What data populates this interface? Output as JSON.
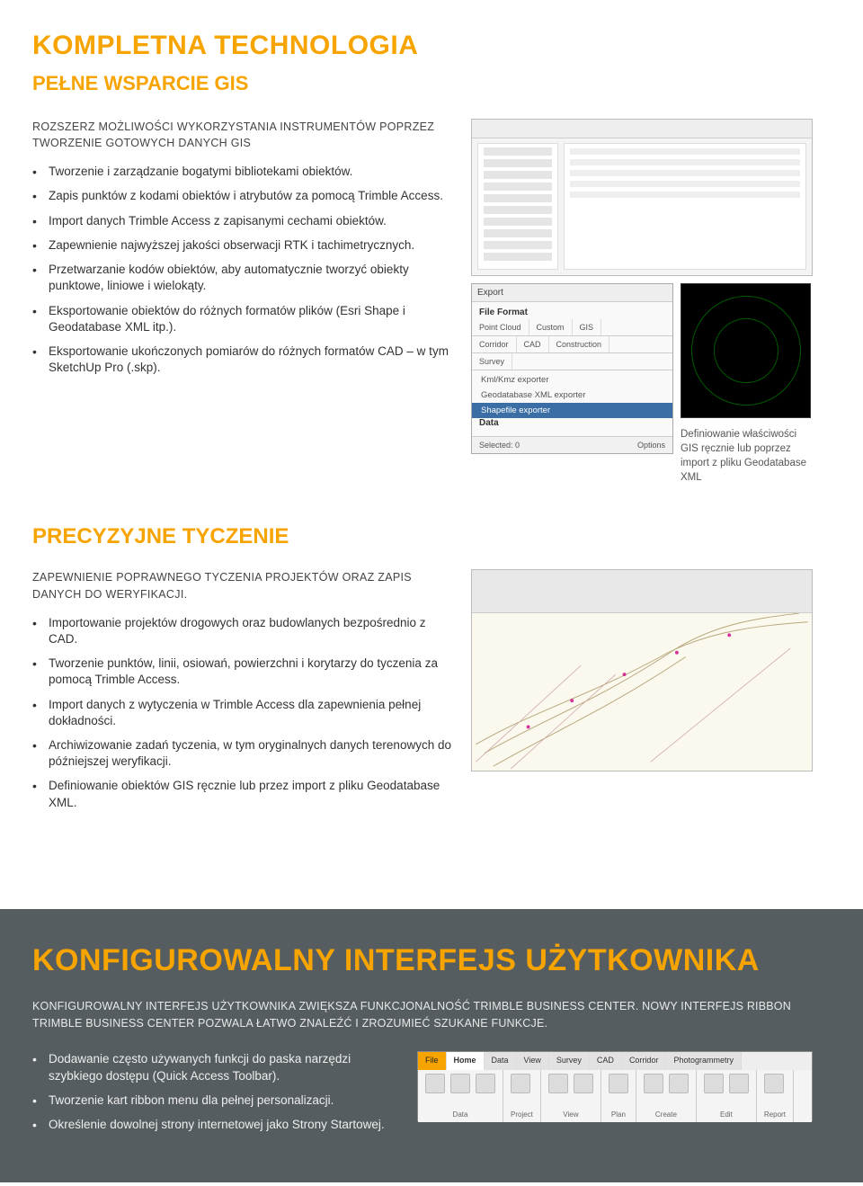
{
  "section1": {
    "title": "KOMPLETNA TECHNOLOGIA",
    "subtitle": "PEŁNE WSPARCIE GIS",
    "lead": "ROZSZERZ MOŻLIWOŚCI WYKORZYSTANIA INSTRUMENTÓW POPRZEZ TWORZENIE GOTOWYCH DANYCH GIS",
    "bullets": [
      "Tworzenie i zarządzanie bogatymi bibliotekami obiektów.",
      "Zapis punktów z kodami obiektów i atrybutów za pomocą Trimble Access.",
      "Import danych Trimble Access z zapisanymi cechami obiektów.",
      "Zapewnienie najwyższej jakości obserwacji RTK i tachimetrycznych.",
      "Przetwarzanie kodów obiektów, aby automatycznie tworzyć obiekty punktowe, liniowe i wielokąty.",
      "Eksportowanie obiektów do różnych formatów plików (Esri Shape i Geodatabase XML itp.).",
      "Eksportowanie ukończonych pomiarów do różnych formatów CAD – w tym SketchUp Pro (.skp)."
    ],
    "export_panel": {
      "title": "Export",
      "section": "File Format",
      "rows": [
        "Point Cloud",
        "Corridor",
        "Survey"
      ],
      "cols": [
        "Custom",
        "CAD",
        "GIS",
        "Construction"
      ],
      "list": [
        "Kml/Kmz exporter",
        "Geodatabase XML exporter",
        "Shapefile exporter"
      ],
      "selected_index": 2,
      "footer_label": "Data",
      "footer_status": "Selected: 0",
      "footer_button": "Options"
    },
    "caption": "Definiowanie właściwości GIS ręcznie lub poprzez import z pliku Geodatabase XML"
  },
  "section2": {
    "title": "PRECYZYJNE TYCZENIE",
    "lead": "ZAPEWNIENIE POPRAWNEGO TYCZENIA PROJEKTÓW ORAZ ZAPIS DANYCH DO WERYFIKACJI.",
    "bullets": [
      "Importowanie projektów drogowych oraz budowlanych bezpośrednio z CAD.",
      "Tworzenie punktów, linii, osiowań, powierzchni i korytarzy do tyczenia za pomocą Trimble Access.",
      "Import danych z wytyczenia w Trimble Access dla zapewnienia pełnej dokładności.",
      "Archiwizowanie zadań tyczenia, w tym oryginalnych danych terenowych do późniejszej weryfikacji.",
      "Definiowanie obiektów GIS ręcznie lub przez import z pliku Geodatabase XML."
    ]
  },
  "section3": {
    "title": "KONFIGUROWALNY INTERFEJS UŻYTKOWNIKA",
    "lead": "KONFIGUROWALNY INTERFEJS UŻYTKOWNIKA ZWIĘKSZA FUNKCJONALNOŚĆ TRIMBLE BUSINESS CENTER. NOWY INTERFEJS RIBBON TRIMBLE BUSINESS CENTER POZWALA ŁATWO ZNALEŹĆ I ZROZUMIEĆ SZUKANE FUNKCJE.",
    "bullets": [
      "Dodawanie często używanych funkcji do paska narzędzi szybkiego dostępu (Quick Access Toolbar).",
      "Tworzenie kart ribbon menu dla pełnej personalizacji.",
      "Określenie dowolnej strony internetowej jako Strony Startowej."
    ],
    "ribbon_tabs": [
      "File",
      "Home",
      "Data",
      "View",
      "Survey",
      "CAD",
      "Corridor",
      "Photogrammetry"
    ],
    "ribbon_groups": [
      "Data",
      "Project",
      "View",
      "Plan",
      "Create",
      "Edit",
      "Report"
    ]
  }
}
